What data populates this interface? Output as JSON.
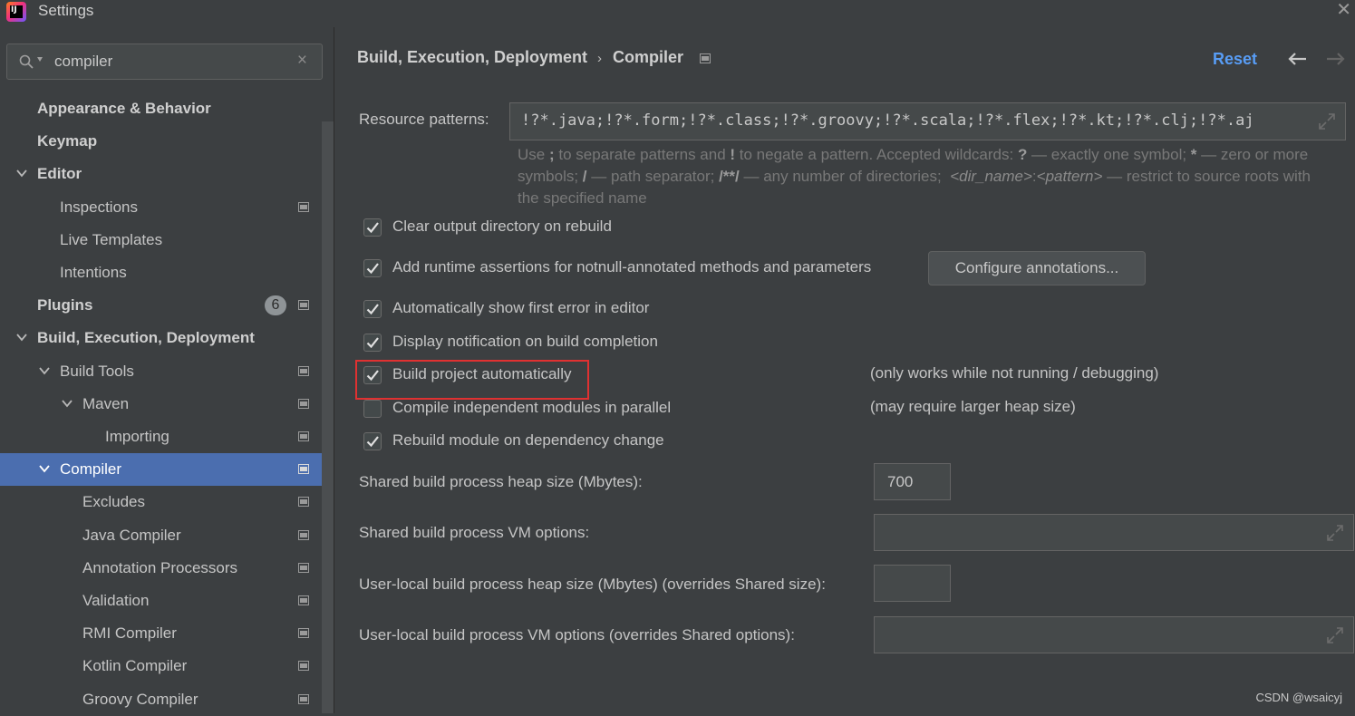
{
  "window": {
    "title": "Settings",
    "icon": "intellij-idea-icon"
  },
  "search": {
    "value": "compiler",
    "icon": "search-icon",
    "clear": "×"
  },
  "tree": [
    {
      "label": "Appearance & Behavior",
      "bold": true,
      "indent": 0,
      "arrow": "none"
    },
    {
      "label": "Keymap",
      "bold": true,
      "indent": 0,
      "arrow": "none"
    },
    {
      "label": "Editor",
      "bold": true,
      "indent": 0,
      "arrow": "down"
    },
    {
      "label": "Inspections",
      "bold": false,
      "indent": 1,
      "arrow": "none",
      "project": true
    },
    {
      "label": "Live Templates",
      "bold": false,
      "indent": 1,
      "arrow": "none"
    },
    {
      "label": "Intentions",
      "bold": false,
      "indent": 1,
      "arrow": "none"
    },
    {
      "label": "Plugins",
      "bold": true,
      "indent": 0,
      "arrow": "none",
      "badge": "6",
      "project": true
    },
    {
      "label": "Build, Execution, Deployment",
      "bold": true,
      "indent": 0,
      "arrow": "down"
    },
    {
      "label": "Build Tools",
      "bold": false,
      "indent": 1,
      "arrow": "down",
      "project": true
    },
    {
      "label": "Maven",
      "bold": false,
      "indent": 2,
      "arrow": "down",
      "project": true
    },
    {
      "label": "Importing",
      "bold": false,
      "indent": 3,
      "arrow": "none",
      "project": true
    },
    {
      "label": "Compiler",
      "bold": false,
      "indent": 1,
      "arrow": "down",
      "project": true,
      "selected": true
    },
    {
      "label": "Excludes",
      "bold": false,
      "indent": 2,
      "arrow": "none",
      "project": true
    },
    {
      "label": "Java Compiler",
      "bold": false,
      "indent": 2,
      "arrow": "none",
      "project": true
    },
    {
      "label": "Annotation Processors",
      "bold": false,
      "indent": 2,
      "arrow": "none",
      "project": true
    },
    {
      "label": "Validation",
      "bold": false,
      "indent": 2,
      "arrow": "none",
      "project": true
    },
    {
      "label": "RMI Compiler",
      "bold": false,
      "indent": 2,
      "arrow": "none",
      "project": true
    },
    {
      "label": "Kotlin Compiler",
      "bold": false,
      "indent": 2,
      "arrow": "none",
      "project": true
    },
    {
      "label": "Groovy Compiler",
      "bold": false,
      "indent": 2,
      "arrow": "none",
      "project": true
    }
  ],
  "header": {
    "crumb_parent": "Build, Execution, Deployment",
    "crumb_sep": "›",
    "crumb_current": "Compiler",
    "reset": "Reset"
  },
  "resource": {
    "label": "Resource patterns:",
    "value": "!?*.java;!?*.form;!?*.class;!?*.groovy;!?*.scala;!?*.flex;!?*.kt;!?*.clj;!?*.aj"
  },
  "options": [
    {
      "label": "Clear output directory on rebuild",
      "checked": true
    },
    {
      "label": "Add runtime assertions for notnull-annotated methods and parameters",
      "checked": true
    },
    {
      "label": "Automatically show first error in editor",
      "checked": true
    },
    {
      "label": "Display notification on build completion",
      "checked": true
    },
    {
      "label": "Build project automatically",
      "checked": true,
      "note": "(only works while not running / debugging)"
    },
    {
      "label": "Compile independent modules in parallel",
      "checked": false,
      "note": "(may require larger heap size)"
    },
    {
      "label": "Rebuild module on dependency change",
      "checked": true
    }
  ],
  "configure_button": "Configure annotations...",
  "fields": {
    "shared_heap_label": "Shared build process heap size (Mbytes):",
    "shared_heap_value": "700",
    "shared_vm_label": "Shared build process VM options:",
    "user_heap_label": "User-local build process heap size (Mbytes) (overrides Shared size):",
    "user_vm_label": "User-local build process VM options (overrides Shared options):"
  },
  "watermark": "CSDN @wsaicyj",
  "colors": {
    "selection": "#4b6eaf",
    "link": "#589df6",
    "highlight": "#e03131"
  }
}
